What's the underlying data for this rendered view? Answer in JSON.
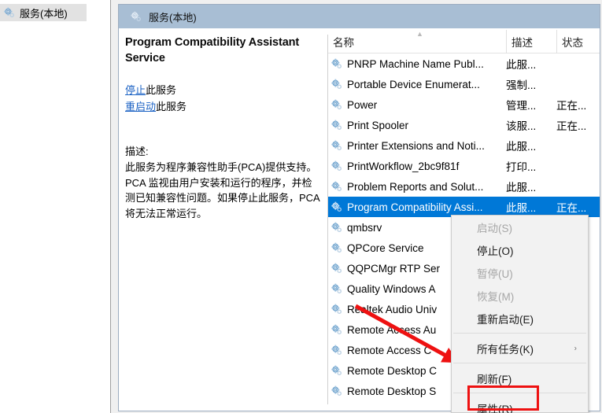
{
  "tree": {
    "items": [
      {
        "label": "服务(本地)",
        "icon": "gear-icon"
      }
    ]
  },
  "detail": {
    "header": {
      "title": "服务(本地)",
      "icon": "gear-icon"
    },
    "service_title": "Program Compatibility Assistant Service",
    "links": [
      {
        "link_text": "停止",
        "suffix": "此服务"
      },
      {
        "link_text": "重启动",
        "suffix": "此服务"
      }
    ],
    "description_label": "描述:",
    "description_body": "此服务为程序兼容性助手(PCA)提供支持。PCA 监视由用户安装和运行的程序，并检测已知兼容性问题。如果停止此服务，PCA 将无法正常运行。"
  },
  "list": {
    "columns": [
      {
        "key": "name",
        "label": "名称",
        "sort": "asc"
      },
      {
        "key": "desc",
        "label": "描述"
      },
      {
        "key": "status",
        "label": "状态"
      }
    ],
    "rows": [
      {
        "name": "PNRP Machine Name Publ...",
        "desc": "此服...",
        "status": "",
        "selected": false
      },
      {
        "name": "Portable Device Enumerat...",
        "desc": "强制...",
        "status": "",
        "selected": false
      },
      {
        "name": "Power",
        "desc": "管理...",
        "status": "正在...",
        "selected": false
      },
      {
        "name": "Print Spooler",
        "desc": "该服...",
        "status": "正在...",
        "selected": false
      },
      {
        "name": "Printer Extensions and Noti...",
        "desc": "此服...",
        "status": "",
        "selected": false
      },
      {
        "name": "PrintWorkflow_2bc9f81f",
        "desc": "打印...",
        "status": "",
        "selected": false
      },
      {
        "name": "Problem Reports and Solut...",
        "desc": "此服...",
        "status": "",
        "selected": false
      },
      {
        "name": "Program Compatibility Assi...",
        "desc": "此服...",
        "status": "正在...",
        "selected": true
      },
      {
        "name": "qmbsrv",
        "desc": "",
        "status": "",
        "selected": false
      },
      {
        "name": "QPCore Service",
        "desc": "",
        "status": "",
        "selected": false
      },
      {
        "name": "QQPCMgr RTP Ser",
        "desc": "",
        "status": "",
        "selected": false
      },
      {
        "name": "Quality Windows A",
        "desc": "",
        "status": "",
        "selected": false
      },
      {
        "name": "Realtek Audio Univ",
        "desc": "",
        "status": "",
        "selected": false
      },
      {
        "name": "Remote Access Au",
        "desc": "",
        "status": "",
        "selected": false
      },
      {
        "name": "Remote Access C",
        "desc": "",
        "status": "",
        "selected": false
      },
      {
        "name": "Remote Desktop C",
        "desc": "",
        "status": "",
        "selected": false
      },
      {
        "name": "Remote Desktop S",
        "desc": "",
        "status": "",
        "selected": false
      }
    ]
  },
  "context_menu": {
    "items": [
      {
        "label": "启动(S)",
        "disabled": true,
        "submenu": false,
        "separator_after": false
      },
      {
        "label": "停止(O)",
        "disabled": false,
        "submenu": false,
        "separator_after": false
      },
      {
        "label": "暂停(U)",
        "disabled": true,
        "submenu": false,
        "separator_after": false
      },
      {
        "label": "恢复(M)",
        "disabled": true,
        "submenu": false,
        "separator_after": false
      },
      {
        "label": "重新启动(E)",
        "disabled": false,
        "submenu": false,
        "separator_after": true
      },
      {
        "label": "所有任务(K)",
        "disabled": false,
        "submenu": true,
        "separator_after": true
      },
      {
        "label": "刷新(F)",
        "disabled": false,
        "submenu": false,
        "separator_after": true
      },
      {
        "label": "属性(R)",
        "disabled": false,
        "submenu": false,
        "separator_after": false,
        "highlighted": true
      }
    ],
    "submenu_arrow": "›"
  },
  "annotations": {
    "arrow_color": "#ee1111",
    "highlight_color": "#ee1111"
  }
}
